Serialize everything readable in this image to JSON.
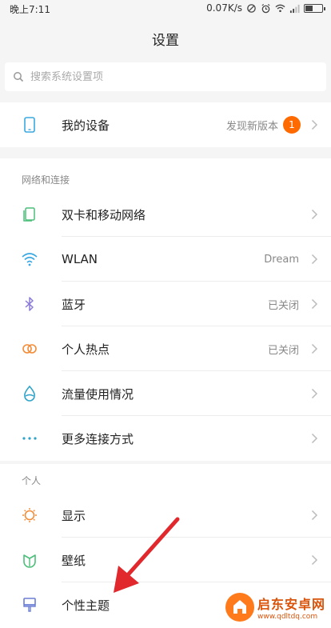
{
  "status_bar": {
    "time": "晚上7:11",
    "speed": "0.07K/s"
  },
  "header": {
    "title": "设置"
  },
  "search": {
    "placeholder": "搜索系统设置项",
    "value": ""
  },
  "device_card": {
    "label": "我的设备",
    "value": "发现新版本",
    "badge": "1"
  },
  "network_section": {
    "header": "网络和连接",
    "items": [
      {
        "label": "双卡和移动网络",
        "value": "",
        "icon": "sim-card-icon"
      },
      {
        "label": "WLAN",
        "value": "Dream",
        "icon": "wifi-icon"
      },
      {
        "label": "蓝牙",
        "value": "已关闭",
        "icon": "bluetooth-icon"
      },
      {
        "label": "个人热点",
        "value": "已关闭",
        "icon": "hotspot-icon"
      },
      {
        "label": "流量使用情况",
        "value": "",
        "icon": "data-usage-icon"
      },
      {
        "label": "更多连接方式",
        "value": "",
        "icon": "more-icon"
      }
    ]
  },
  "personal_section": {
    "header": "个人",
    "items": [
      {
        "label": "显示",
        "value": "",
        "icon": "display-icon"
      },
      {
        "label": "壁纸",
        "value": "",
        "icon": "wallpaper-icon"
      },
      {
        "label": "个性主题",
        "value": "",
        "icon": "theme-icon"
      }
    ]
  },
  "watermark": {
    "title": "启东安卓网",
    "url": "www.qdltdq.com"
  },
  "colors": {
    "accent": "#3aa8e0",
    "badge": "#ff6a00",
    "annotation_arrow": "#e0282d"
  }
}
